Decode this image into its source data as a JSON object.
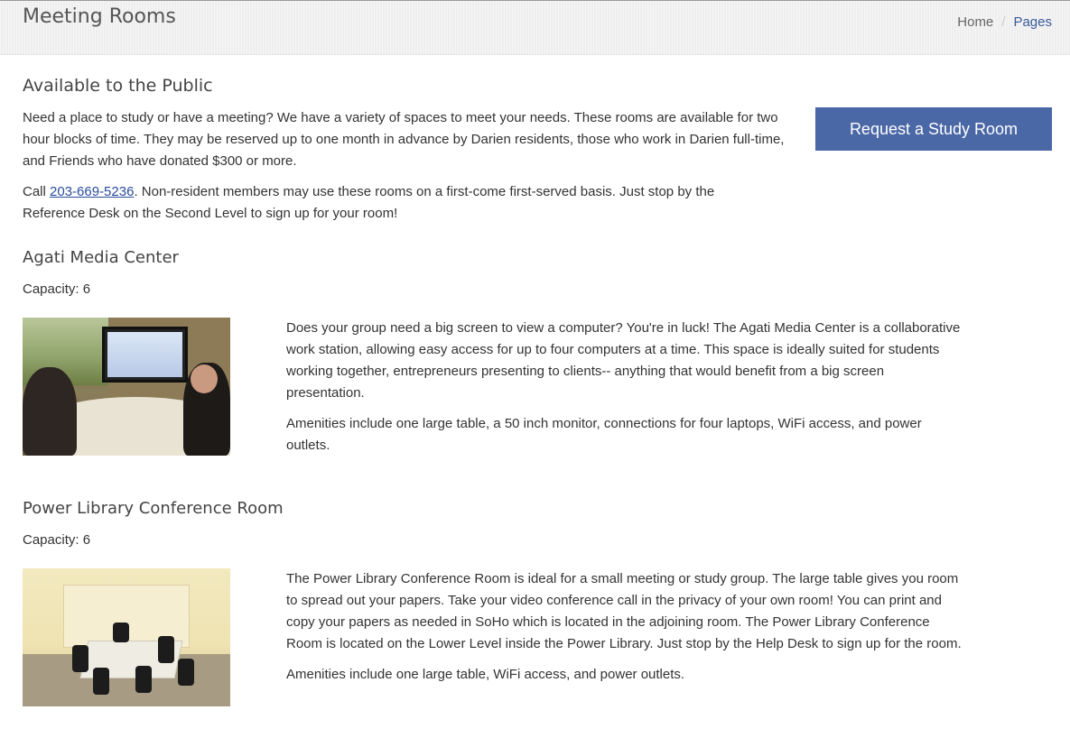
{
  "header": {
    "title": "Meeting Rooms",
    "breadcrumb": {
      "home": "Home",
      "separator": "/",
      "current": "Pages"
    }
  },
  "intro": {
    "heading": "Available to the Public",
    "paragraph1": "Need a place to study or have a meeting? We have a variety of spaces to meet your needs. These rooms are available for two hour blocks of time. They may be reserved up to one month in advance by Darien residents, those who work in Darien full-time, and Friends who have donated $300 or more.",
    "paragraph2_prefix": "Call ",
    "phone": "203-669-5236",
    "paragraph2_suffix": ". Non-resident members may use these rooms on a first-come first-served basis. Just stop by the Reference Desk on the Second Level to sign up for your room!",
    "request_button": "Request a Study Room"
  },
  "rooms": [
    {
      "name": "Agati Media Center",
      "capacity": "Capacity: 6",
      "description": "Does your group need a big screen to view a computer? You're in luck! The Agati Media Center is a collaborative work station, allowing easy access for up to four computers at a time. This space is ideally suited for students working together, entrepreneurs presenting to clients-- anything that would benefit from a big screen presentation.",
      "amenities": "Amenities include one large table, a 50 inch monitor, connections for four laptops, WiFi access, and power outlets."
    },
    {
      "name": "Power Library Conference Room",
      "capacity": "Capacity: 6",
      "description": "The Power Library Conference Room is ideal for a small meeting or study group. The large table gives you room to spread out your papers. Take your video conference call in the privacy of your own room! You can print and copy your papers as needed in SoHo which is located in the adjoining room. The Power Library Conference Room is located on the Lower Level inside the Power Library. Just stop by the Help Desk to sign up for the room.",
      "amenities": "Amenities include one large table, WiFi access, and power outlets."
    }
  ],
  "colors": {
    "accent_button": "#4a67a6",
    "link": "#2a4d9c",
    "breadcrumb_current": "#3a5a9a"
  }
}
